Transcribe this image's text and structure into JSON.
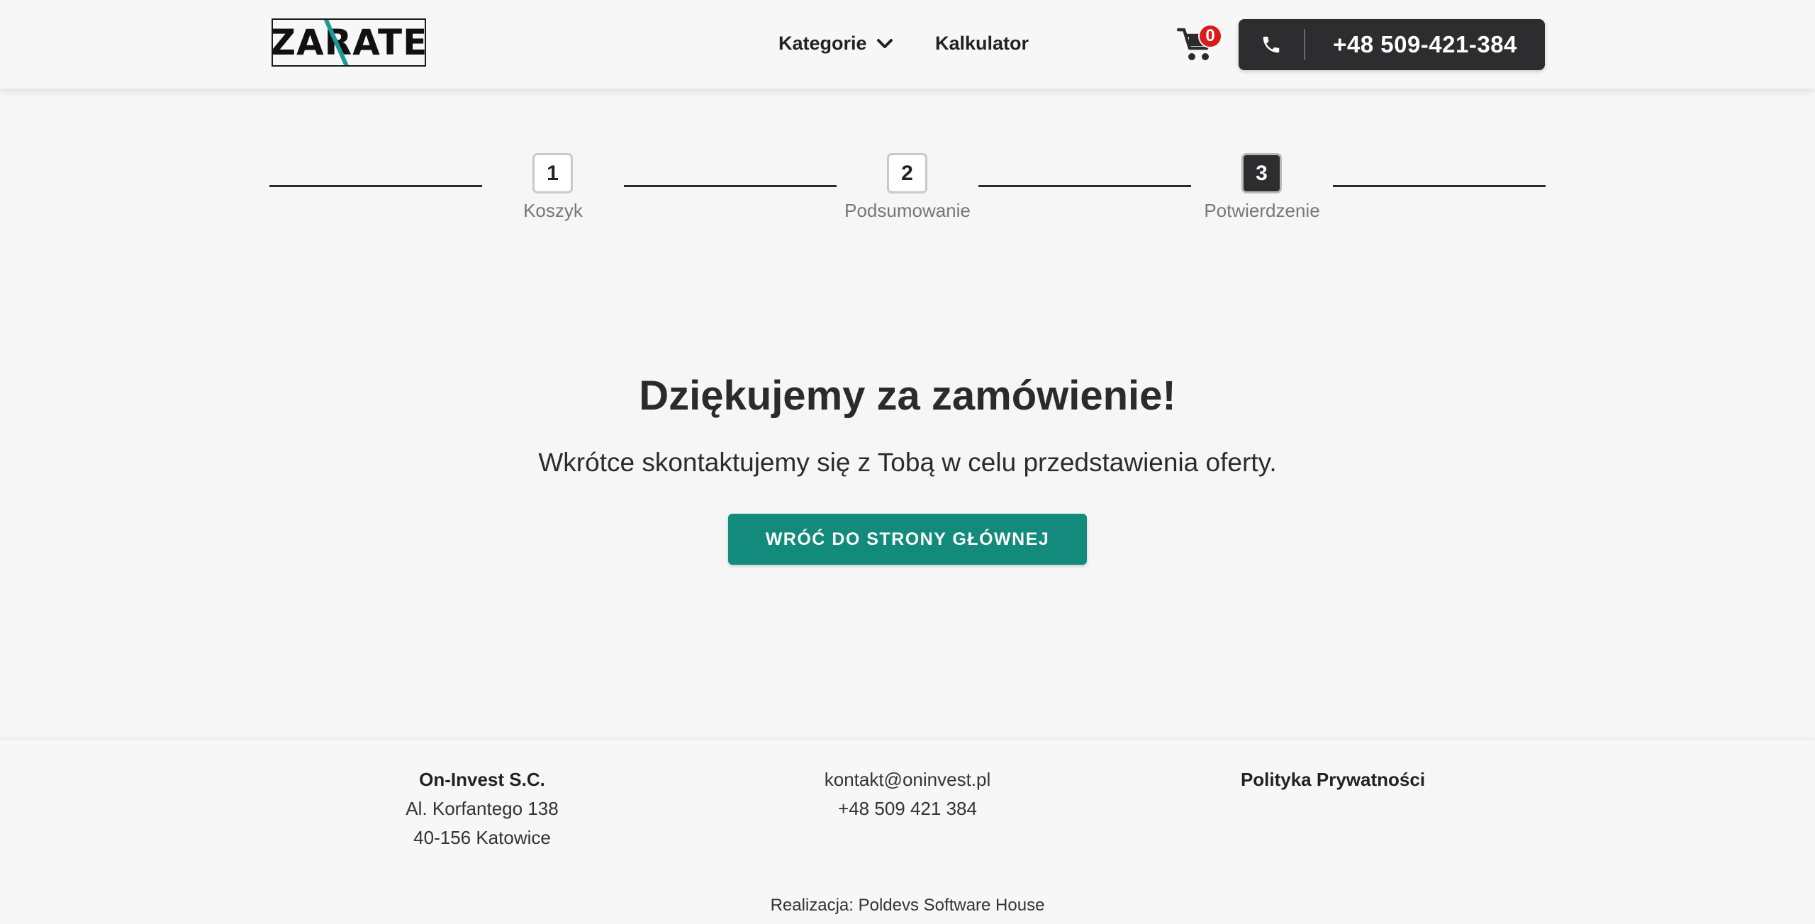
{
  "header": {
    "logo_text": "ZARATE",
    "nav": {
      "categories_label": "Kategorie",
      "calculator_label": "Kalkulator"
    },
    "cart_count": "0",
    "phone": "+48 509-421-384"
  },
  "stepper": {
    "steps": [
      {
        "number": "1",
        "label": "Koszyk"
      },
      {
        "number": "2",
        "label": "Podsumowanie"
      },
      {
        "number": "3",
        "label": "Potwierdzenie"
      }
    ],
    "active_step": 3
  },
  "main": {
    "title": "Dziękujemy za zamówienie!",
    "subtitle": "Wkrótce skontaktujemy się z Tobą w celu przedstawienia oferty.",
    "home_button": "WRÓĆ DO STRONY GŁÓWNEJ"
  },
  "footer": {
    "company": {
      "name": "On-Invest S.C.",
      "street": "Al. Korfantego 138",
      "city": "40-156 Katowice"
    },
    "contact": {
      "email": "kontakt@oninvest.pl",
      "phone": "+48 509 421 384"
    },
    "privacy_label": "Polityka Prywatności",
    "credit": "Realizacja: Poldevs Software House"
  },
  "colors": {
    "accent": "#128a7c",
    "dark": "#2d2d2f",
    "badge": "#d81b1b",
    "background": "#f6f6f6"
  }
}
